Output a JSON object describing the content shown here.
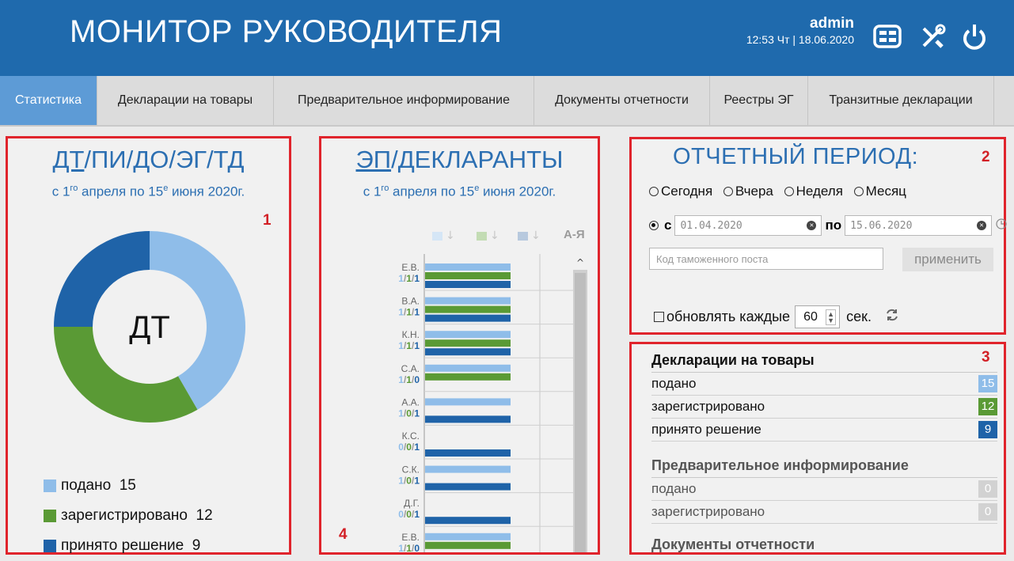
{
  "header": {
    "title": "МОНИТОР РУКОВОДИТЕЛЯ",
    "user": "admin",
    "datetime": "12:53 Чт | 18.06.2020"
  },
  "tabs": [
    {
      "label": "Статистика",
      "active": true
    },
    {
      "label": "Декларации на товары"
    },
    {
      "label": "Предварительное информирование"
    },
    {
      "label": "Документы отчетности"
    },
    {
      "label": "Реестры ЭГ"
    },
    {
      "label": "Транзитные декларации"
    }
  ],
  "colors": {
    "submitted": "#8fbde9",
    "registered": "#5a9a35",
    "decided": "#1f63a8",
    "header": "#1f6aad",
    "marker": "#e0242c"
  },
  "panel1": {
    "number": "1",
    "nav": [
      "ДТ",
      "ПИ",
      "ДО",
      "ЭГ",
      "ТД"
    ],
    "sep": "/",
    "period_a": "с 1",
    "period_sup1": "го",
    "period_b": " апреля по 15",
    "period_sup2": "е",
    "period_c": " июня 2020г.",
    "center": "ДТ",
    "legend": [
      {
        "label": "подано",
        "value": "15"
      },
      {
        "label": "зарегистрировано",
        "value": "12"
      },
      {
        "label": "принято решение",
        "value": "9"
      }
    ]
  },
  "panel2": {
    "number": "4",
    "nav": [
      "ЭП",
      "ДЕКЛАРАНТЫ"
    ],
    "sep": "/",
    "period_a": "с 1",
    "period_sup1": "го",
    "period_b": " апреля по 15",
    "period_sup2": "е",
    "period_c": " июня 2020г.",
    "sort_az": "А-Я",
    "scroll_up": "^",
    "sort_arrow": "↓"
  },
  "chart_data": {
    "type": "bar",
    "orientation": "horizontal",
    "categories": [
      "Е.В.",
      "В.А.",
      "К.Н.",
      "С.А.",
      "А.А.",
      "К.С.",
      "С.К.",
      "Д.Г.",
      "Е.В."
    ],
    "counts_label": [
      "1/1/1",
      "1/1/1",
      "1/1/1",
      "1/1/0",
      "1/0/1",
      "0/0/1",
      "1/0/1",
      "0/0/1",
      "1/1/0"
    ],
    "series": [
      {
        "name": "подано",
        "values": [
          1,
          1,
          1,
          1,
          1,
          0,
          1,
          0,
          1
        ]
      },
      {
        "name": "зарегистрировано",
        "values": [
          1,
          1,
          1,
          1,
          0,
          0,
          0,
          0,
          1
        ]
      },
      {
        "name": "принято решение",
        "values": [
          1,
          1,
          1,
          0,
          1,
          1,
          1,
          1,
          0
        ]
      }
    ],
    "xlim": [
      0,
      1
    ]
  },
  "period": {
    "number": "2",
    "title": "ОТЧЕТНЫЙ ПЕРИОД:",
    "options": [
      "Сегодня",
      "Вчера",
      "Неделя",
      "Месяц"
    ],
    "from_label": "с",
    "to_label": "по",
    "from_date": "01.04.2020",
    "to_date": "15.06.2020",
    "post_placeholder": "Код таможенного поста",
    "apply": "применить",
    "refresh_label": "обновлять каждые",
    "refresh_value": "60",
    "refresh_unit": "сек."
  },
  "stats": {
    "number": "3",
    "sections": [
      {
        "title": "Декларации на товары",
        "rows": [
          {
            "label": "подано",
            "value": "15"
          },
          {
            "label": "зарегистрировано",
            "value": "12"
          },
          {
            "label": "принято решение",
            "value": "9"
          }
        ]
      },
      {
        "title": "Предварительное информирование",
        "rows": [
          {
            "label": "подано",
            "value": "0"
          },
          {
            "label": "зарегистрировано",
            "value": "0"
          }
        ]
      },
      {
        "title": "Документы отчетности",
        "rows": []
      }
    ]
  }
}
